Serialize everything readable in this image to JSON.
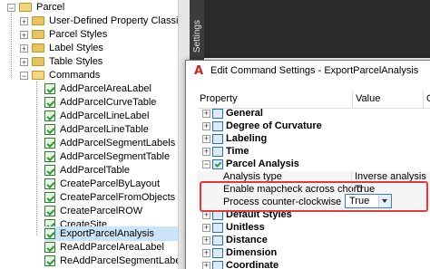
{
  "tree": {
    "items": [
      {
        "label": "Parcel",
        "kind": "folder-open",
        "expander": "−"
      },
      {
        "label": "User-Defined Property Classificatio...",
        "kind": "folder",
        "expander": "+"
      },
      {
        "label": "Parcel Styles",
        "kind": "folder",
        "expander": "+"
      },
      {
        "label": "Label Styles",
        "kind": "folder",
        "expander": "+"
      },
      {
        "label": "Table Styles",
        "kind": "folder",
        "expander": "+"
      },
      {
        "label": "Commands",
        "kind": "folder-open",
        "expander": "−"
      },
      {
        "label": "AddParcelAreaLabel",
        "kind": "command"
      },
      {
        "label": "AddParcelCurveTable",
        "kind": "command"
      },
      {
        "label": "AddParcelLineLabel",
        "kind": "command"
      },
      {
        "label": "AddParcelLineTable",
        "kind": "command"
      },
      {
        "label": "AddParcelSegmentLabels",
        "kind": "command"
      },
      {
        "label": "AddParcelSegmentTable",
        "kind": "command"
      },
      {
        "label": "AddParcelTable",
        "kind": "command"
      },
      {
        "label": "CreateParcelByLayout",
        "kind": "command"
      },
      {
        "label": "CreateParcelFromObjects",
        "kind": "command"
      },
      {
        "label": "CreateParcelROW",
        "kind": "command"
      },
      {
        "label": "CreateSite",
        "kind": "command"
      },
      {
        "label": "ExportParcelAnalysis",
        "kind": "command",
        "selected": true
      },
      {
        "label": "ReAddParcelAreaLabel",
        "kind": "command"
      },
      {
        "label": "ReAddParcelSegmentLabels",
        "kind": "command"
      }
    ]
  },
  "settings_tab": "Settings",
  "dialog": {
    "title": "Edit Command Settings - ExportParcelAnalysis",
    "col_property": "Property",
    "col_value": "Value",
    "col_override": "Ov",
    "categories": {
      "general": "General",
      "degree": "Degree of Curvature",
      "labeling": "Labeling",
      "time": "Time",
      "parcel_analysis": "Parcel Analysis",
      "default_styles": "Default Styles",
      "unitless": "Unitless",
      "distance": "Distance",
      "dimension": "Dimension",
      "coordinate": "Coordinate"
    },
    "rows": {
      "analysis_type": {
        "label": "Analysis type",
        "value": "Inverse analysis"
      },
      "mapcheck": {
        "label": "Enable mapcheck across chord",
        "value": "True"
      },
      "ccw": {
        "label": "Process counter-clockwise",
        "value": "True"
      }
    }
  },
  "colors": {
    "highlight": "#e53935",
    "selection": "#cce4f7"
  }
}
